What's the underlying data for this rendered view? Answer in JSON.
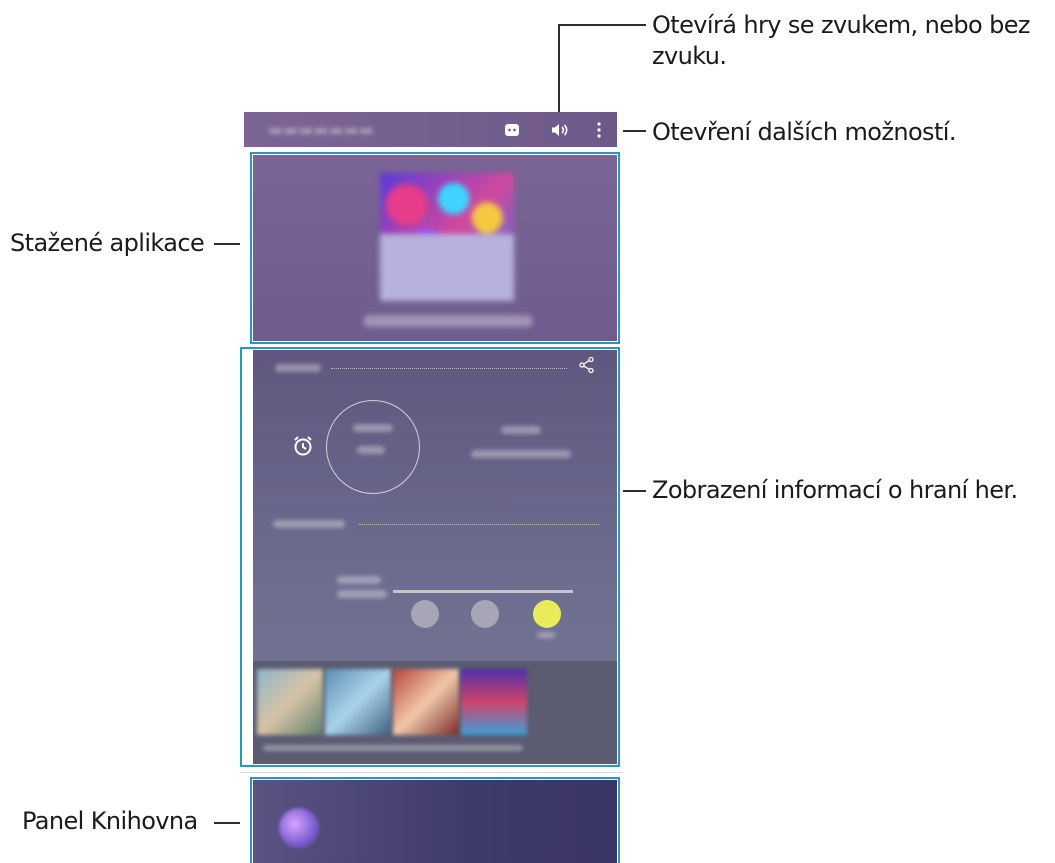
{
  "callouts": {
    "sound": "Otevírá hry se zvukem, nebo bez zvuku.",
    "sound_line1": "Otevírá hry se zvukem, nebo bez",
    "sound_line2": "zvuku.",
    "more_options": "Otevření dalších možností.",
    "downloaded_apps": "Stažené aplikace",
    "play_info": "Zobrazení informací o hraní her.",
    "library_panel": "Panel Knihovna"
  },
  "toolbar": {
    "icons": [
      "discord-icon",
      "volume-icon",
      "more-options-icon"
    ]
  },
  "colors": {
    "highlight": "#2d93c6",
    "leader_line": "#2e2e2e",
    "topbar": "#7b6595",
    "knob_active": "#e8ec5a",
    "knob_inactive": "#a8a8b8"
  }
}
